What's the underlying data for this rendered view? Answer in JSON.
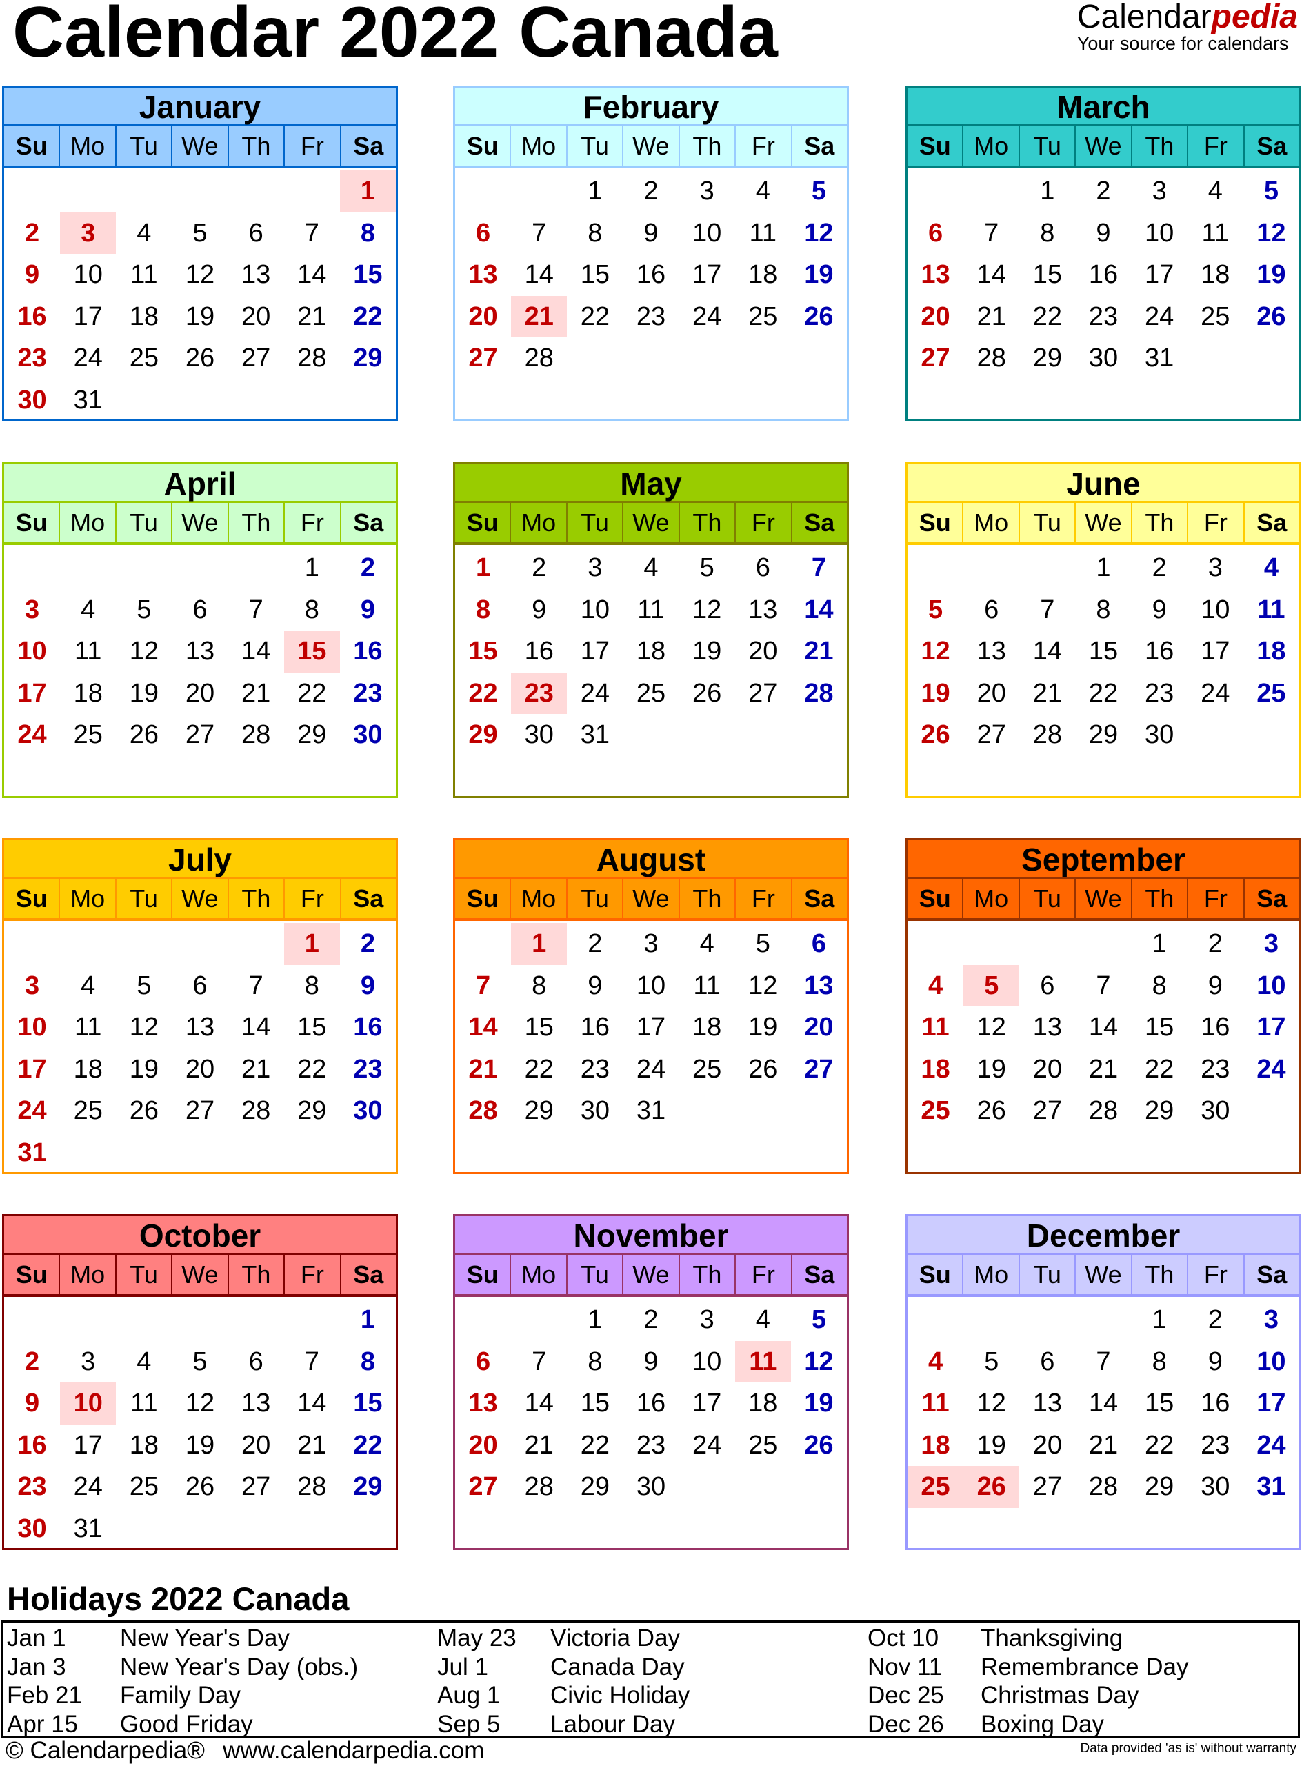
{
  "title": "Calendar 2022 Canada",
  "logo": {
    "name_plain": "Calendar",
    "name_accent": "pedia",
    "tagline": "Your source for calendars"
  },
  "weekdays": [
    "Su",
    "Mo",
    "Tu",
    "We",
    "Th",
    "Fr",
    "Sa"
  ],
  "colors": {
    "sunday": "#c00000",
    "saturday": "#0000b0",
    "holiday_bg": "#ffd9d9"
  },
  "months": [
    {
      "name": "January",
      "start": 6,
      "days": 31,
      "holidays": [
        1,
        3
      ],
      "head_bg": "#99ccff",
      "border": "#0066cc"
    },
    {
      "name": "February",
      "start": 2,
      "days": 28,
      "holidays": [
        21
      ],
      "head_bg": "#ccffff",
      "border": "#99ccff"
    },
    {
      "name": "March",
      "start": 2,
      "days": 31,
      "holidays": [],
      "head_bg": "#33cccc",
      "border": "#008080"
    },
    {
      "name": "April",
      "start": 5,
      "days": 30,
      "holidays": [
        15
      ],
      "head_bg": "#ccffcc",
      "border": "#99cc00"
    },
    {
      "name": "May",
      "start": 0,
      "days": 31,
      "holidays": [
        23
      ],
      "head_bg": "#99cc00",
      "border": "#808000"
    },
    {
      "name": "June",
      "start": 3,
      "days": 30,
      "holidays": [],
      "head_bg": "#ffff99",
      "border": "#ffcc00"
    },
    {
      "name": "July",
      "start": 5,
      "days": 31,
      "holidays": [
        1
      ],
      "head_bg": "#ffcc00",
      "border": "#ff9900"
    },
    {
      "name": "August",
      "start": 1,
      "days": 31,
      "holidays": [
        1
      ],
      "head_bg": "#ff9900",
      "border": "#ff6600"
    },
    {
      "name": "September",
      "start": 4,
      "days": 30,
      "holidays": [
        5
      ],
      "head_bg": "#ff6600",
      "border": "#993300"
    },
    {
      "name": "October",
      "start": 6,
      "days": 31,
      "holidays": [
        10
      ],
      "head_bg": "#ff8080",
      "border": "#800000"
    },
    {
      "name": "November",
      "start": 2,
      "days": 30,
      "holidays": [
        11
      ],
      "head_bg": "#cc99ff",
      "border": "#993366"
    },
    {
      "name": "December",
      "start": 4,
      "days": 31,
      "holidays": [
        25,
        26
      ],
      "head_bg": "#ccccff",
      "border": "#9999ff"
    }
  ],
  "holidays_title": "Holidays 2022 Canada",
  "holidays": [
    [
      {
        "date": "Jan 1",
        "name": "New Year's Day"
      },
      {
        "date": "Jan 3",
        "name": "New Year's Day (obs.)"
      },
      {
        "date": "Feb 21",
        "name": "Family Day"
      },
      {
        "date": "Apr 15",
        "name": "Good Friday"
      }
    ],
    [
      {
        "date": "May 23",
        "name": "Victoria Day"
      },
      {
        "date": "Jul 1",
        "name": "Canada Day"
      },
      {
        "date": "Aug 1",
        "name": "Civic Holiday"
      },
      {
        "date": "Sep 5",
        "name": "Labour Day"
      }
    ],
    [
      {
        "date": "Oct 10",
        "name": "Thanksgiving"
      },
      {
        "date": "Nov 11",
        "name": "Remembrance Day"
      },
      {
        "date": "Dec 25",
        "name": "Christmas Day"
      },
      {
        "date": "Dec 26",
        "name": "Boxing Day"
      }
    ]
  ],
  "footer": {
    "copyright": "© Calendarpedia®",
    "url": "www.calendarpedia.com",
    "disclaimer": "Data provided 'as is' without warranty"
  }
}
